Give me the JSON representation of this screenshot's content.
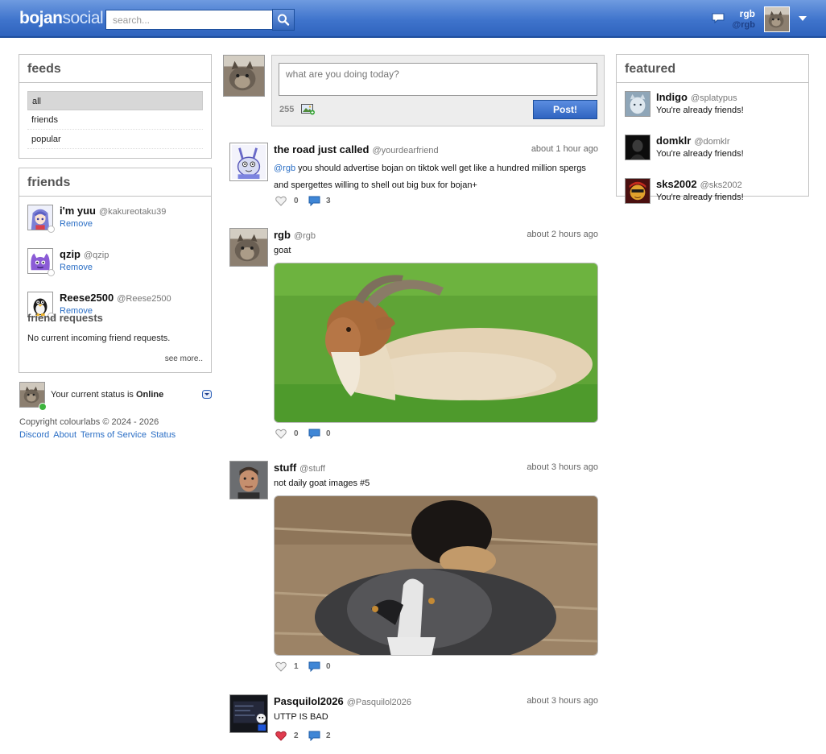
{
  "colors": {
    "brand": "#3f74cc",
    "link": "#2a6ec5",
    "online": "#3cb43c",
    "like_active": "#e03b4e"
  },
  "header": {
    "logo_b": "b",
    "logo_ojan": "ojan",
    "logo_social": "social",
    "search_placeholder": "search...",
    "search_icon": "magnifier-icon",
    "notifications_icon": "speech-bubble-icon",
    "user_name": "rgb",
    "user_handle": "@rgb",
    "menu_icon": "caret-down-icon"
  },
  "feeds": {
    "title": "feeds",
    "items": [
      {
        "label": "all",
        "active": true
      },
      {
        "label": "friends",
        "active": false
      },
      {
        "label": "popular",
        "active": false
      }
    ]
  },
  "friends": {
    "title": "friends",
    "list": [
      {
        "name": "i'm yuu",
        "handle": "@kakureotaku39",
        "action": "Remove"
      },
      {
        "name": "qzip",
        "handle": "@qzip",
        "action": "Remove"
      },
      {
        "name": "Reese2500",
        "handle": "@Reese2500",
        "action": "Remove"
      }
    ],
    "requests_title": "friend requests",
    "requests_text": "No current incoming friend requests.",
    "see_more": "see more.."
  },
  "status": {
    "prefix": "Your current status is",
    "value": "Online"
  },
  "footer": {
    "copyright": "Copyright colourlabs © 2024 - 2026",
    "links": [
      "Discord",
      "About",
      "Terms of Service",
      "Status"
    ]
  },
  "composer": {
    "placeholder": "what are you doing today?",
    "char_count": "255",
    "post_label": "Post!",
    "image_icon": "image-upload-icon"
  },
  "posts": [
    {
      "name": "the road just called",
      "handle": "@yourdearfriend",
      "time": "about 1 hour ago",
      "mention": "@rgb",
      "text": " you should advertise bojan on tiktok well get like a hundred million spergs and spergettes willing to shell out big bux for bojan+",
      "likes": "0",
      "comments": "3",
      "liked": false
    },
    {
      "name": "rgb",
      "handle": "@rgb",
      "time": "about 2 hours ago",
      "mention": "",
      "text": "goat",
      "likes": "0",
      "comments": "0",
      "liked": false
    },
    {
      "name": "stuff",
      "handle": "@stuff",
      "time": "about 3 hours ago",
      "mention": "",
      "text": "not daily goat images #5",
      "likes": "1",
      "comments": "0",
      "liked": false
    },
    {
      "name": "Pasquilol2026",
      "handle": "@Pasquilol2026",
      "time": "about 3 hours ago",
      "mention": "",
      "text": "UTTP IS BAD",
      "likes": "2",
      "comments": "2",
      "liked": true
    }
  ],
  "featured": {
    "title": "featured",
    "list": [
      {
        "name": "Indigo",
        "handle": "@splatypus",
        "status": "You're already friends!"
      },
      {
        "name": "domklr",
        "handle": "@domklr",
        "status": "You're already friends!"
      },
      {
        "name": "sks2002",
        "handle": "@sks2002",
        "status": "You're already friends!"
      }
    ]
  }
}
